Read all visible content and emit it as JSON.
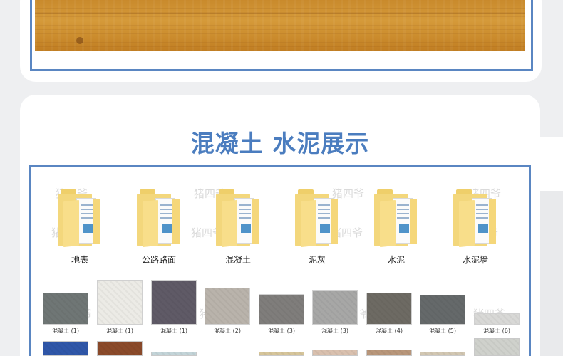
{
  "section_title": "混凝土 水泥展示",
  "watermark": "猪四爷",
  "folders": [
    {
      "label": "地表"
    },
    {
      "label": "公路路面"
    },
    {
      "label": "混凝土"
    },
    {
      "label": "泥灰"
    },
    {
      "label": "水泥"
    },
    {
      "label": "水泥墙"
    }
  ],
  "thumbnails": [
    {
      "caption": "混凝土 (1)",
      "color": "#6f7675"
    },
    {
      "caption": "混凝土 (1)",
      "color": "#ecebe6"
    },
    {
      "caption": "混凝土 (1)",
      "color": "#5f5a66"
    },
    {
      "caption": "混凝土 (2)",
      "color": "#b9b3ab"
    },
    {
      "caption": "混凝土 (3)",
      "color": "#7f7d7b"
    },
    {
      "caption": "混凝土 (3)",
      "color": "#a7a7a6"
    },
    {
      "caption": "混凝土 (4)",
      "color": "#6d6a63"
    },
    {
      "caption": "混凝土 (5)",
      "color": "#65696a"
    },
    {
      "caption": "混凝土 (6)",
      "color": "#d8d8d6"
    }
  ],
  "thumbnails_row2_colors": [
    "#2f56a8",
    "#8a4a2a",
    "#c3d4d8",
    "#ffffff",
    "#d6c59a",
    "#d9c0ae",
    "#b8967a",
    "#d2c7b2",
    "#cfd1cc"
  ],
  "colors": {
    "accent": "#5a86c2",
    "title": "#4b7dbf"
  }
}
